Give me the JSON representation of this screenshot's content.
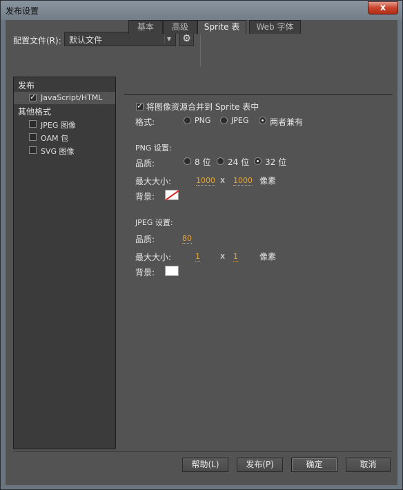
{
  "window": {
    "title": "发布设置",
    "close_glyph": "x"
  },
  "profile": {
    "label": "配置文件(R):",
    "value": "默认文件",
    "gear_glyph": "⚙"
  },
  "sidebar": {
    "publish_heading": "发布",
    "publish_items": [
      {
        "label": "JavaScript/HTML",
        "checked": true
      }
    ],
    "other_heading": "其他格式",
    "other_items": [
      {
        "label": "JPEG 图像",
        "checked": false
      },
      {
        "label": "OAM 包",
        "checked": false
      },
      {
        "label": "SVG 图像",
        "checked": false
      }
    ]
  },
  "tabs": [
    "基本",
    "高级",
    "Sprite 表",
    "Web 字体"
  ],
  "active_tab": "Sprite 表",
  "sprite": {
    "merge_label": "将图像资源合并到 Sprite 表中",
    "merge_checked": true,
    "format_label": "格式:",
    "format_options": [
      "PNG",
      "JPEG",
      "两者兼有"
    ],
    "format_selected": "两者兼有",
    "png": {
      "heading": "PNG 设置:",
      "quality_label": "品质:",
      "quality_options": [
        "8 位",
        "24 位",
        "32 位"
      ],
      "quality_selected": "32 位",
      "maxsize_label": "最大大小:",
      "width": "1000",
      "x": "x",
      "height": "1000",
      "unit": "像素",
      "bg_label": "背景:",
      "bg_color": "none"
    },
    "jpeg": {
      "heading": "JPEG 设置:",
      "quality_label": "品质:",
      "quality": "80",
      "maxsize_label": "最大大小:",
      "width": "1",
      "x": "x",
      "height": "1",
      "unit": "像素",
      "bg_label": "背景:",
      "bg_color": "#ffffff"
    }
  },
  "buttons": {
    "help": "帮助(L)",
    "publish": "发布(P)",
    "ok": "确定",
    "cancel": "取消"
  }
}
